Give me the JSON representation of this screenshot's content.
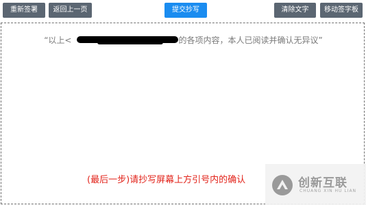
{
  "toolbar": {
    "resign_label": "重新签署",
    "back_label": "返回上一页",
    "submit_label": "提交抄写",
    "clear_label": "清除文字",
    "move_label": "移动签字板"
  },
  "board": {
    "statement_prefix": "“以上<",
    "statement_suffix": ">的各项内容，本人已阅读并确认无异议”",
    "hint": "(最后一步)请抄写屏幕上方引号内的确认"
  },
  "watermark": {
    "brand": "创新互联",
    "brand_pinyin": "CHUANG XIN HU LIAN"
  },
  "colors": {
    "button_gray": "#5b6672",
    "button_blue": "#1a8cf0",
    "hint_red": "#e2231a",
    "statement_gray": "#7a7a7a"
  }
}
